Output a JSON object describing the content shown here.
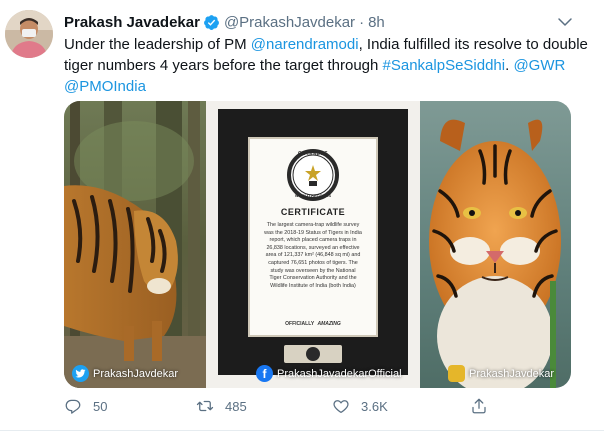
{
  "tweet": {
    "author_name": "Prakash Javadekar",
    "handle": "@PrakashJavdekar",
    "separator": "·",
    "time": "8h",
    "text_segments": [
      {
        "text": "Under the leadership of PM ",
        "link": false
      },
      {
        "text": "@narendramodi",
        "link": true
      },
      {
        "text": ", India fulfilled its resolve to double tiger numbers 4 years before the target through ",
        "link": false
      },
      {
        "text": "#SankalpSeSiddhi",
        "link": true
      },
      {
        "text": ". ",
        "link": false
      },
      {
        "text": "@GWR",
        "link": true
      },
      {
        "text": " ",
        "link": false
      },
      {
        "text": "@PMOIndia",
        "link": true
      }
    ]
  },
  "media": {
    "certificate": {
      "brand_top": "GUINNESS",
      "brand_bottom": "WORLD RECORDS",
      "heading": "CERTIFICATE",
      "body_lines": [
        "The largest camera-trap wildlife survey",
        "was the 2018-19 Status of Tigers in India",
        "report, which placed camera traps in",
        "26,838 locations, surveyed an effective",
        "area of 121,337 km² (46,848 sq mi) and",
        "captured 76,651 photos of tigers. The",
        "study was overseen by the National",
        "Tiger Conservation Authority and the",
        "Wildlife Institute of India (both India)"
      ],
      "footer_label": "OFFICIALLY",
      "footer_word": "AMAZING"
    },
    "watermarks": {
      "twitter": "PrakashJavdekar",
      "facebook": "PrakashJavadekarOfficial",
      "koo": "PrakashJavdekar"
    }
  },
  "actions": {
    "reply_count": "50",
    "retweet_count": "485",
    "like_count": "3.6K"
  },
  "colors": {
    "link": "#1b95e0",
    "secondary_text": "#5b7083",
    "verified": "#1da1f2"
  }
}
